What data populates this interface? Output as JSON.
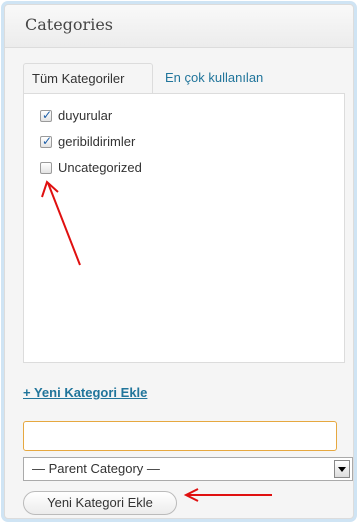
{
  "panel": {
    "title": "Categories"
  },
  "tabs": [
    {
      "label": "Tüm Kategoriler",
      "active": true
    },
    {
      "label": "En çok kullanılan",
      "active": false
    }
  ],
  "categories": [
    {
      "label": "duyurular",
      "checked": true
    },
    {
      "label": "geribildirimler",
      "checked": true
    },
    {
      "label": "Uncategorized",
      "checked": false
    }
  ],
  "add_link_label": "+ Yeni Kategori Ekle",
  "new_category_input": {
    "value": "",
    "placeholder": ""
  },
  "parent_select": {
    "selected": "— Parent Category —"
  },
  "submit_button_label": "Yeni Kategori Ekle",
  "colors": {
    "link": "#21759b",
    "annotation_arrow": "#e01010",
    "input_focus_border": "#e6a840"
  },
  "icons": {
    "checkbox_checked": "checkmark-icon",
    "select_arrow": "chevron-down-icon"
  }
}
